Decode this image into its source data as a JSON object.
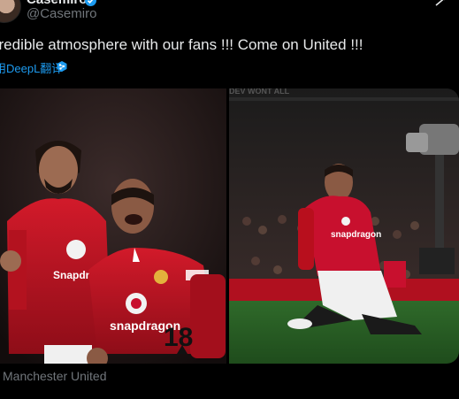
{
  "header": {
    "display_name": "Casemiro",
    "handle": "@Casemiro",
    "avatar_icon": "avatar-photo",
    "verified_icon": "verified-badge-icon",
    "menu_icon": "grok-icon"
  },
  "tweet": {
    "text": "credible atmosphere with our fans !!! Come on United !!!",
    "translate_label": "用DeepL翻译",
    "translate_icon": "deepl-icon"
  },
  "media": {
    "left_photo": {
      "jersey_number": "18",
      "sponsor": "snapdragon"
    },
    "right_photo": {
      "stadium_banner": "DEV WONT ALL",
      "sponsor": "snapdragon"
    }
  },
  "caption": "Manchester United",
  "colors": {
    "background": "#000000",
    "text": "#e7e9ea",
    "secondary": "#71767b",
    "link": "#1d9bf0",
    "kit_red": "#c8102e"
  }
}
